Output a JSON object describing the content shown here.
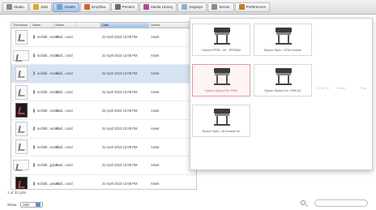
{
  "toolbar": {
    "buttons": [
      {
        "label": "Studio",
        "color": "#8a8a8a",
        "active": false
      },
      {
        "label": "Jobs",
        "color": "#d9a62b",
        "active": false
      },
      {
        "label": "Assets",
        "color": "#7a9cc6",
        "active": true
      },
      {
        "label": "Dropflow",
        "color": "#d2623a",
        "active": false
      },
      {
        "label": "Printers",
        "color": "#6b6b6b",
        "active": false
      },
      {
        "label": "Media Library",
        "color": "#b24b8b",
        "active": false
      },
      {
        "label": "Displays",
        "color": "#8fb0d6",
        "active": false
      },
      {
        "label": "Server",
        "color": "#8b8b8b",
        "active": false
      },
      {
        "label": "Preferences",
        "color": "#c47a2e",
        "active": false
      }
    ]
  },
  "table": {
    "columns": [
      "Thumbnail",
      "Name",
      "Status",
      "Date",
      "Queue"
    ],
    "sorted_column": "Date",
    "rows": [
      {
        "name": "scribbl...red.tif",
        "status": "Avail...cond",
        "date": "22 April 2010 12:08 PM",
        "queue": "Asset",
        "thumb": "light",
        "selected": false
      },
      {
        "name": "scribbl...red.tif",
        "status": "Avail...cond",
        "date": "22 April 2010 12:08 PM",
        "queue": "Asset",
        "thumb": "wide",
        "selected": false
      },
      {
        "name": "scribbl...red.tif",
        "status": "Avail...cond",
        "date": "22 April 2010 12:08 PM",
        "queue": "Asset",
        "thumb": "light",
        "selected": true
      },
      {
        "name": "scribbl...red.tif",
        "status": "Avail...cond",
        "date": "22 April 2010 12:08 PM",
        "queue": "Asset",
        "thumb": "light",
        "selected": false
      },
      {
        "name": "scribbl...red.tif",
        "status": "Avail...cond",
        "date": "22 April 2010 12:08 PM",
        "queue": "Asset",
        "thumb": "dark",
        "selected": false
      },
      {
        "name": "scribbl...red.tif",
        "status": "Avail...cond",
        "date": "22 April 2010 12:08 PM",
        "queue": "Asset",
        "thumb": "light",
        "selected": false
      },
      {
        "name": "scribbl...red.tif",
        "status": "Avail...cond",
        "date": "22 April 2010 12:08 PM",
        "queue": "Asset",
        "thumb": "light",
        "selected": false
      },
      {
        "name": "scribbl...jpd.tif",
        "status": "Avail...cond",
        "date": "22 April 2010 12:08 PM",
        "queue": "Asset",
        "thumb": "wide",
        "selected": false
      },
      {
        "name": "scribbl...ack.tif",
        "status": "Avail...cond",
        "date": "22 April 2010 12:08 PM",
        "queue": "Asset",
        "thumb": "dark",
        "selected": false
      }
    ]
  },
  "status_text": "1 of 32 jobs",
  "show": {
    "label": "Show:",
    "value": "Jobs"
  },
  "popup": {
    "printers": [
      {
        "label": "Canon iPF50...00 - iPF8000",
        "selected": false
      },
      {
        "label": "Epson Stylu...H7M module",
        "selected": false
      },
      {
        "label": "Epson Stylus Pro 7900",
        "selected": true
      },
      {
        "label": "Epson Stylus Pro 7900 #2",
        "selected": false
      },
      {
        "label": "Epson Stylu...M module #1",
        "selected": false
      }
    ],
    "ghost_text": [
      "12:08 PM",
      "Printer",
      "Pha"
    ]
  }
}
